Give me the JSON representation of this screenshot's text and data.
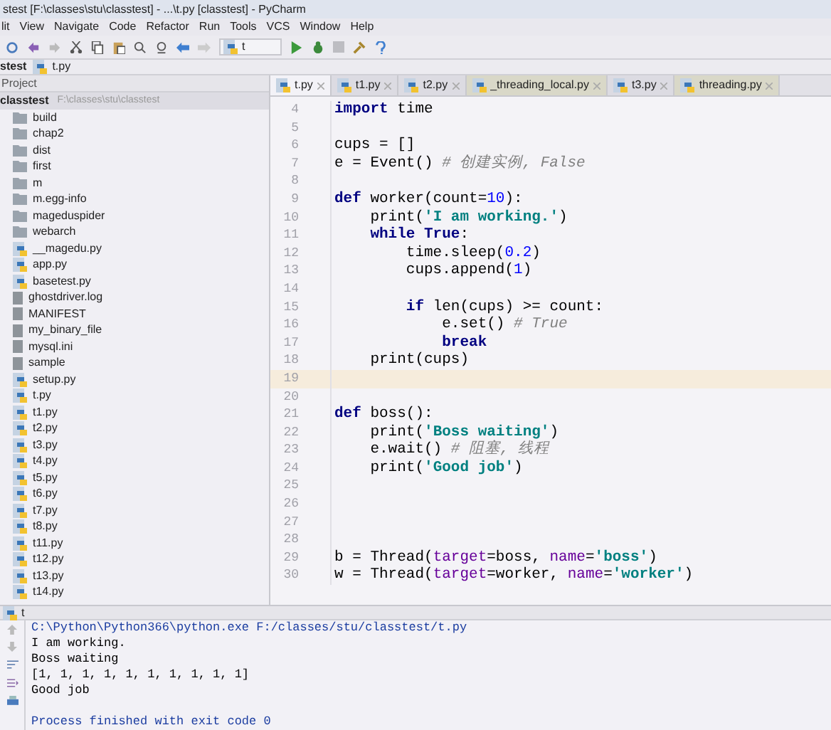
{
  "window": {
    "title": "stest [F:\\classes\\stu\\classtest] - ...\\t.py [classtest] - PyCharm"
  },
  "menu": [
    "lit",
    "View",
    "Navigate",
    "Code",
    "Refactor",
    "Run",
    "Tools",
    "VCS",
    "Window",
    "Help"
  ],
  "toolbar": {
    "run_config": "t"
  },
  "breadcrumb": [
    "stest",
    "t.py"
  ],
  "project_panel": {
    "title": "Project",
    "root": {
      "name": "classtest",
      "path": "F:\\classes\\stu\\classtest"
    },
    "items": [
      {
        "name": "build",
        "kind": "folder"
      },
      {
        "name": "chap2",
        "kind": "folder"
      },
      {
        "name": "dist",
        "kind": "folder"
      },
      {
        "name": "first",
        "kind": "folder"
      },
      {
        "name": "m",
        "kind": "folder"
      },
      {
        "name": "m.egg-info",
        "kind": "folder"
      },
      {
        "name": "mageduspider",
        "kind": "folder"
      },
      {
        "name": "webarch",
        "kind": "folder"
      },
      {
        "name": "__magedu.py",
        "kind": "python"
      },
      {
        "name": "app.py",
        "kind": "python"
      },
      {
        "name": "basetest.py",
        "kind": "python"
      },
      {
        "name": "ghostdriver.log",
        "kind": "file"
      },
      {
        "name": "MANIFEST",
        "kind": "file"
      },
      {
        "name": "my_binary_file",
        "kind": "file"
      },
      {
        "name": "mysql.ini",
        "kind": "file"
      },
      {
        "name": "sample",
        "kind": "file"
      },
      {
        "name": "setup.py",
        "kind": "python"
      },
      {
        "name": "t.py",
        "kind": "python"
      },
      {
        "name": "t1.py",
        "kind": "python"
      },
      {
        "name": "t2.py",
        "kind": "python"
      },
      {
        "name": "t3.py",
        "kind": "python"
      },
      {
        "name": "t4.py",
        "kind": "python"
      },
      {
        "name": "t5.py",
        "kind": "python"
      },
      {
        "name": "t6.py",
        "kind": "python"
      },
      {
        "name": "t7.py",
        "kind": "python"
      },
      {
        "name": "t8.py",
        "kind": "python"
      },
      {
        "name": "t11.py",
        "kind": "python"
      },
      {
        "name": "t12.py",
        "kind": "python"
      },
      {
        "name": "t13.py",
        "kind": "python"
      },
      {
        "name": "t14.py",
        "kind": "python"
      }
    ]
  },
  "editor_tabs": [
    {
      "label": "t.py",
      "selected": true
    },
    {
      "label": "t1.py",
      "selected": false
    },
    {
      "label": "t2.py",
      "selected": false
    },
    {
      "label": "_threading_local.py",
      "selected": false
    },
    {
      "label": "t3.py",
      "selected": false
    },
    {
      "label": "threading.py",
      "selected": false
    }
  ],
  "code": [
    {
      "number": "4",
      "current": false,
      "tokens": [
        {
          "kind": "kw",
          "text": "import"
        },
        {
          "kind": "plain",
          "text": " time"
        }
      ]
    },
    {
      "number": "5",
      "current": false
    },
    {
      "number": "6",
      "current": false,
      "tokens": [
        {
          "kind": "plain",
          "text": "cups = []"
        }
      ]
    },
    {
      "number": "7",
      "current": false,
      "tokens": [
        {
          "kind": "plain",
          "text": "e = Event() "
        },
        {
          "kind": "cmt",
          "text": "# 创建实例, False"
        }
      ]
    },
    {
      "number": "8",
      "current": false
    },
    {
      "number": "9",
      "current": false,
      "tokens": [
        {
          "kind": "kw",
          "text": "def"
        },
        {
          "kind": "plain",
          "text": " worker(count="
        },
        {
          "kind": "num",
          "text": "10"
        },
        {
          "kind": "plain",
          "text": "):"
        }
      ]
    },
    {
      "number": "10",
      "current": false,
      "tokens": [
        {
          "kind": "plain",
          "text": "    print("
        },
        {
          "kind": "str",
          "text": "'I am working.'"
        },
        {
          "kind": "plain",
          "text": ")"
        }
      ]
    },
    {
      "number": "11",
      "current": false,
      "tokens": [
        {
          "kind": "kw",
          "text": "    while True"
        },
        {
          "kind": "plain",
          "text": ":"
        }
      ]
    },
    {
      "number": "12",
      "current": false,
      "tokens": [
        {
          "kind": "plain",
          "text": "        time.sleep("
        },
        {
          "kind": "num",
          "text": "0.2"
        },
        {
          "kind": "plain",
          "text": ")"
        }
      ]
    },
    {
      "number": "13",
      "current": false,
      "tokens": [
        {
          "kind": "plain",
          "text": "        cups.append("
        },
        {
          "kind": "num",
          "text": "1"
        },
        {
          "kind": "plain",
          "text": ")"
        }
      ]
    },
    {
      "number": "14",
      "current": false
    },
    {
      "number": "15",
      "current": false,
      "tokens": [
        {
          "kind": "kw",
          "text": "        if"
        },
        {
          "kind": "plain",
          "text": " len(cups) >= count:"
        }
      ]
    },
    {
      "number": "16",
      "current": false,
      "tokens": [
        {
          "kind": "plain",
          "text": "            e.set() "
        },
        {
          "kind": "cmt",
          "text": "# True"
        }
      ]
    },
    {
      "number": "17",
      "current": false,
      "tokens": [
        {
          "kind": "kw",
          "text": "            break"
        }
      ]
    },
    {
      "number": "18",
      "current": false,
      "tokens": [
        {
          "kind": "plain",
          "text": "    print(cups)"
        }
      ]
    },
    {
      "number": "19",
      "current": true
    },
    {
      "number": "20",
      "current": false
    },
    {
      "number": "21",
      "current": false,
      "tokens": [
        {
          "kind": "kw",
          "text": "def"
        },
        {
          "kind": "plain",
          "text": " boss():"
        }
      ]
    },
    {
      "number": "22",
      "current": false,
      "tokens": [
        {
          "kind": "plain",
          "text": "    print("
        },
        {
          "kind": "str",
          "text": "'Boss waiting'"
        },
        {
          "kind": "plain",
          "text": ")"
        }
      ]
    },
    {
      "number": "23",
      "current": false,
      "tokens": [
        {
          "kind": "plain",
          "text": "    e.wait() "
        },
        {
          "kind": "cmt",
          "text": "# 阻塞, 线程"
        }
      ]
    },
    {
      "number": "24",
      "current": false,
      "tokens": [
        {
          "kind": "plain",
          "text": "    print("
        },
        {
          "kind": "str",
          "text": "'Good job'"
        },
        {
          "kind": "plain",
          "text": ")"
        }
      ]
    },
    {
      "number": "25",
      "current": false
    },
    {
      "number": "26",
      "current": false
    },
    {
      "number": "27",
      "current": false
    },
    {
      "number": "28",
      "current": false
    },
    {
      "number": "29",
      "current": false,
      "tokens": [
        {
          "kind": "plain",
          "text": "b = Thread("
        },
        {
          "kind": "param",
          "text": "target"
        },
        {
          "kind": "plain",
          "text": "=boss, "
        },
        {
          "kind": "param",
          "text": "name"
        },
        {
          "kind": "plain",
          "text": "="
        },
        {
          "kind": "str",
          "text": "'boss'"
        },
        {
          "kind": "plain",
          "text": ")"
        }
      ]
    },
    {
      "number": "30",
      "current": false,
      "tokens": [
        {
          "kind": "plain",
          "text": "w = Thread("
        },
        {
          "kind": "param",
          "text": "target"
        },
        {
          "kind": "plain",
          "text": "=worker, "
        },
        {
          "kind": "param",
          "text": "name"
        },
        {
          "kind": "plain",
          "text": "="
        },
        {
          "kind": "str",
          "text": "'worker'"
        },
        {
          "kind": "plain",
          "text": ")"
        }
      ]
    }
  ],
  "run_panel": {
    "tab": "t",
    "output": [
      {
        "kind": "command",
        "text": "C:\\Python\\Python366\\python.exe F:/classes/stu/classtest/t.py"
      },
      {
        "kind": "output",
        "text": "I am working."
      },
      {
        "kind": "output",
        "text": "Boss waiting"
      },
      {
        "kind": "output",
        "text": "[1, 1, 1, 1, 1, 1, 1, 1, 1, 1]"
      },
      {
        "kind": "output",
        "text": "Good job"
      },
      {
        "kind": "status",
        "text": "Process finished with exit code 0"
      }
    ]
  }
}
